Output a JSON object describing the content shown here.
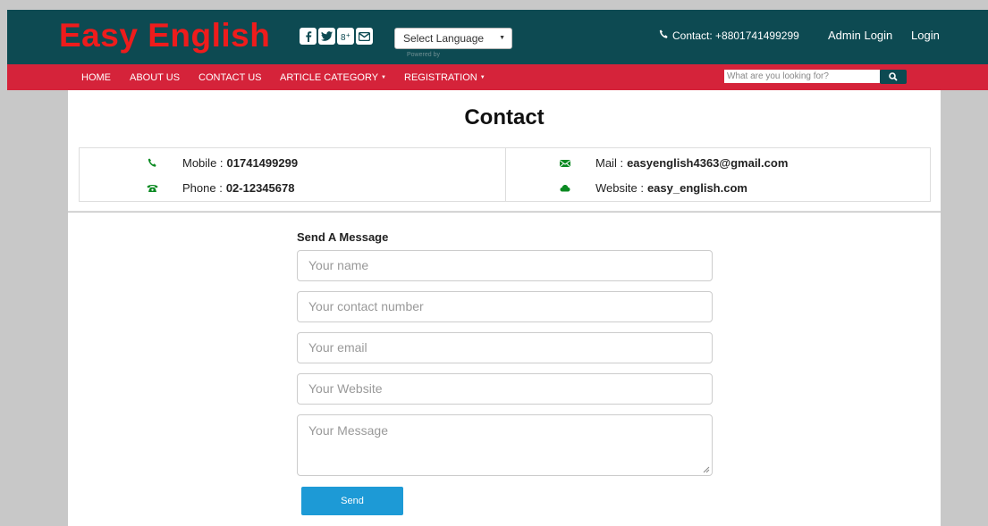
{
  "header": {
    "logo": "Easy English",
    "language_select": "Select Language",
    "powered_by": "Powered by",
    "contact": "Contact: +8801741499299",
    "admin_login": "Admin Login",
    "login": "Login",
    "social_icons": [
      "facebook-icon",
      "twitter-icon",
      "google-plus-icon",
      "mail-icon"
    ]
  },
  "nav": {
    "items": [
      "HOME",
      "ABOUT US",
      "CONTACT US",
      "ARTICLE CATEGORY",
      "REGISTRATION"
    ],
    "search_placeholder": "What are you looking for?"
  },
  "contact": {
    "title": "Contact",
    "mobile_label": "Mobile :",
    "mobile_value": "01741499299",
    "phone_label": "Phone :",
    "phone_value": "02-12345678",
    "mail_label": "Mail :",
    "mail_value": "easyenglish4363@gmail.com",
    "website_label": "Website :",
    "website_value": "easy_english.com"
  },
  "form": {
    "title": "Send A Message",
    "name_placeholder": "Your name",
    "contact_placeholder": "Your contact number",
    "email_placeholder": "Your email",
    "website_placeholder": "Your Website",
    "message_placeholder": "Your Message",
    "send_label": "Send"
  },
  "colors": {
    "header_bg": "#0d4a52",
    "nav_bg": "#d5233a",
    "logo": "#ee1c1c",
    "icon_green": "#0b8a22",
    "button": "#1d9ad6"
  }
}
